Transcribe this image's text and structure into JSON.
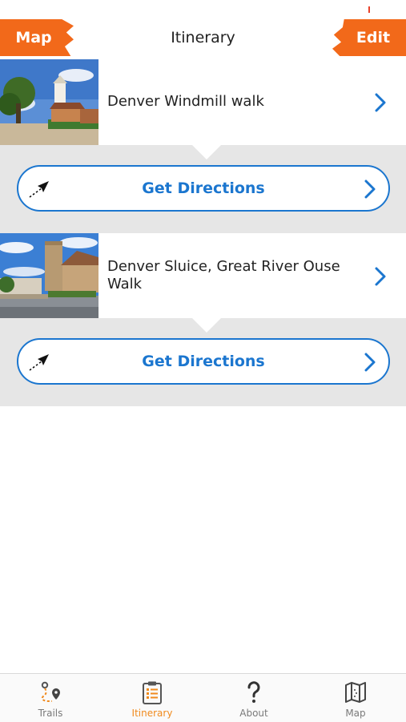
{
  "header": {
    "title": "Itinerary",
    "left_button": "Map",
    "right_button": "Edit",
    "accent_color": "#f2691a"
  },
  "trails": [
    {
      "name": "Denver Windmill walk",
      "thumbnail": "windmill-photo",
      "directions_label": "Get Directions"
    },
    {
      "name": "Denver Sluice, Great River Ouse Walk",
      "thumbnail": "church-photo",
      "directions_label": "Get Directions"
    }
  ],
  "tabbar": {
    "tabs": [
      {
        "label": "Trails",
        "icon": "trails-route-icon",
        "active": false
      },
      {
        "label": "Itinerary",
        "icon": "clipboard-list-icon",
        "active": true
      },
      {
        "label": "About",
        "icon": "question-mark-icon",
        "active": false
      },
      {
        "label": "Map",
        "icon": "folded-map-icon",
        "active": false
      }
    ],
    "active_color": "#f08a1d",
    "inactive_color": "#7a7a7a"
  },
  "link_color": "#1b76cf"
}
